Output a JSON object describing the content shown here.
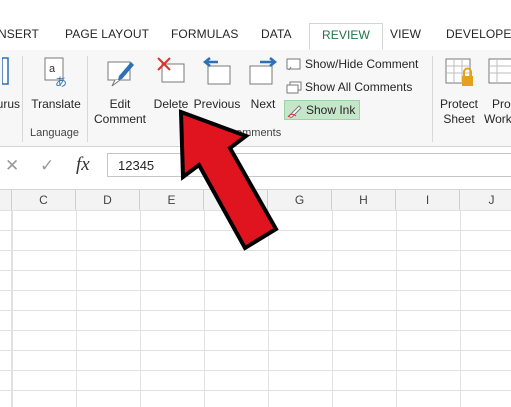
{
  "ribbon_tabs": [
    {
      "label": "INSERT",
      "display": "NSERT"
    },
    {
      "label": "PAGE LAYOUT"
    },
    {
      "label": "FORMULAS"
    },
    {
      "label": "DATA"
    },
    {
      "label": "REVIEW",
      "active": true
    },
    {
      "label": "VIEW"
    },
    {
      "label": "DEVELOPER"
    }
  ],
  "ribbon": {
    "thesaurus_partial": "urus",
    "translate": "Translate",
    "language_group": "Language",
    "edit_comment_line1": "Edit",
    "edit_comment_line2": "Comment",
    "delete": "Delete",
    "previous": "Previous",
    "next": "Next",
    "show_hide_comment": "Show/Hide Comment",
    "show_all_comments": "Show All Comments",
    "show_ink": "Show Ink",
    "comments_group_partial": "omments",
    "protect_sheet_line1": "Protect",
    "protect_sheet_line2": "Sheet",
    "protect_workbook_line1": "Pro",
    "protect_workbook_line2": "Work"
  },
  "formula_bar": {
    "cancel_glyph": "✕",
    "enter_glyph": "✓",
    "fx_label": "fx",
    "value": "12345"
  },
  "columns": [
    "C",
    "D",
    "E",
    "F",
    "G",
    "H",
    "I",
    "J"
  ],
  "colors": {
    "accent": "#217346",
    "arrow": "#e0141e",
    "show_ink_highlight": "#c5e6c9"
  }
}
